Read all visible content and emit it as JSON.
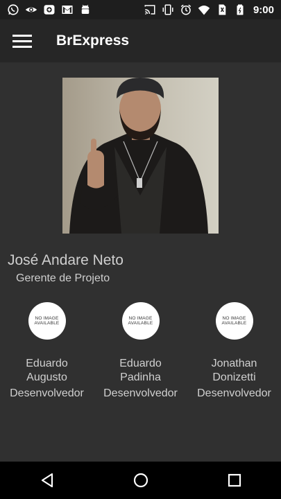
{
  "status_bar": {
    "time": "9:00",
    "left_icons": [
      "whatsapp-icon",
      "eye-icon",
      "photo-icon",
      "gmail-icon",
      "android-icon"
    ],
    "right_icons": [
      "cast-icon",
      "vibrate-icon",
      "alarm-icon",
      "wifi-icon",
      "no-sim-icon",
      "battery-icon"
    ]
  },
  "app_bar": {
    "title": "BrExpress"
  },
  "lead": {
    "name": "José Andare Neto",
    "role": "Gerente de Projeto"
  },
  "team": [
    {
      "name": "Eduardo Augusto",
      "role": "Desenvolvedor",
      "avatar_text": [
        "NO IMAGE",
        "AVAILABLE"
      ]
    },
    {
      "name": "Eduardo Padinha",
      "role": "Desenvolvedor",
      "avatar_text": [
        "NO IMAGE",
        "AVAILABLE"
      ]
    },
    {
      "name": "Jonathan Donizetti",
      "role": "Desenvolvedor",
      "avatar_text": [
        "NO IMAGE",
        "AVAILABLE"
      ]
    }
  ],
  "nav_bar": {
    "buttons": [
      "back-icon",
      "home-icon",
      "recents-icon"
    ]
  },
  "colors": {
    "background": "#303030",
    "app_bar": "#262626",
    "text_muted": "#cfcfcf"
  }
}
